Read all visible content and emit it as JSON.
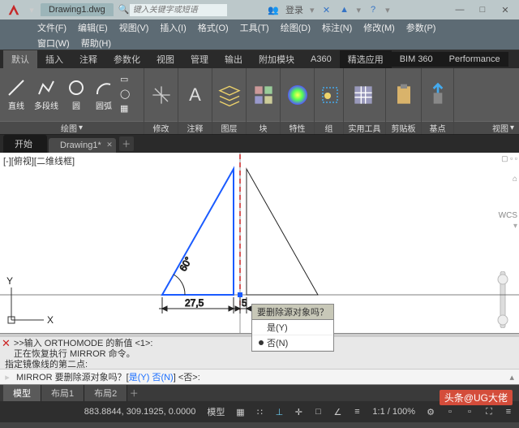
{
  "title_file": "Drawing1.dwg",
  "search_placeholder": "键入关键字或短语",
  "login": "登录",
  "menus": [
    "文件(F)",
    "编辑(E)",
    "视图(V)",
    "插入(I)",
    "格式(O)",
    "工具(T)",
    "绘图(D)",
    "标注(N)",
    "修改(M)",
    "参数(P)"
  ],
  "menus2": [
    "窗口(W)",
    "帮助(H)"
  ],
  "ribtabs": [
    "默认",
    "插入",
    "注释",
    "参数化",
    "视图",
    "管理",
    "输出",
    "附加模块",
    "A360",
    "精选应用",
    "BIM 360",
    "Performance"
  ],
  "ribbon": {
    "draw": {
      "title": "绘图",
      "line": "直线",
      "polyline": "多段线",
      "circle": "圆",
      "arc": "圆弧"
    },
    "modify": "修改",
    "annotate": "注释",
    "layer": "图层",
    "block": "块",
    "props": "特性",
    "group": "组",
    "utils": "实用工具",
    "clip": "剪贴板",
    "base": "基点",
    "view": "视图"
  },
  "filetabs": {
    "start": "开始",
    "draw": "Drawing1*"
  },
  "viewlabel": "[-][俯视][二维线框]",
  "wcs": "WCS",
  "dims": {
    "angle": "60°",
    "width": "27,5",
    "gap": "5"
  },
  "prompt": {
    "q": "要删除源对象吗？",
    "yes": "是(Y)",
    "no": "否(N)"
  },
  "cmdlog": {
    "l1": ">>输入 ORTHOMODE 的新值 <1>:",
    "l2": "正在恢复执行 MIRROR 命令。",
    "l3": "指定镜像线的第二点:"
  },
  "cmdprompt_pre": "MIRROR 要删除源对象吗？[",
  "cmdprompt_yes": "是(Y)",
  "cmdprompt_sep": " ",
  "cmdprompt_no": "否(N)",
  "cmdprompt_suf": "] <否>:",
  "modeltabs": {
    "model": "模型",
    "l1": "布局1",
    "l2": "布局2"
  },
  "status": {
    "coords": "883.8844, 309.1925, 0.0000",
    "model": "模型",
    "scale": "1:1 / 100%"
  },
  "watermark": "头条@UG大佬"
}
